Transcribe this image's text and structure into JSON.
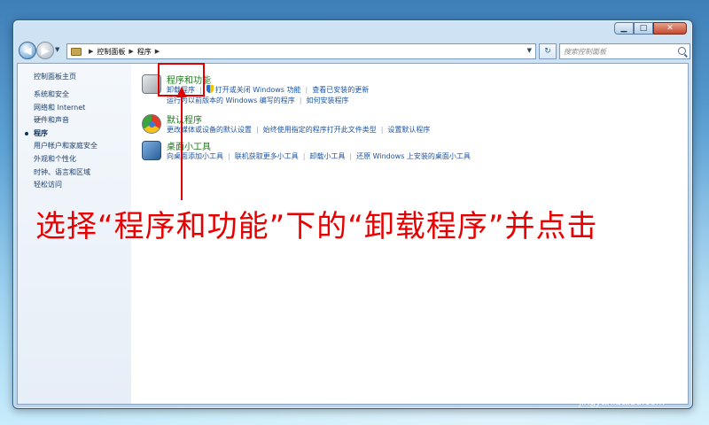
{
  "window": {
    "controls": {
      "minimize": "▁",
      "maximize": "□",
      "close": "✕"
    }
  },
  "address_bar": {
    "breadcrumbs": [
      "控制面板",
      "程序"
    ],
    "search_placeholder": "搜索控制面板"
  },
  "sidebar": {
    "home": "控制面板主页",
    "items": [
      {
        "label": "系统和安全"
      },
      {
        "label": "网络和 Internet"
      },
      {
        "label": "硬件和声音"
      },
      {
        "label": "程序",
        "active": true
      },
      {
        "label": "用户帐户和家庭安全"
      },
      {
        "label": "外观和个性化"
      },
      {
        "label": "时钟、语言和区域"
      },
      {
        "label": "轻松访问"
      }
    ]
  },
  "categories": [
    {
      "title": "程序和功能",
      "icon": "programs-icon",
      "link_rows": [
        [
          "卸载程序",
          "打开或关闭 Windows 功能",
          "查看已安装的更新"
        ],
        [
          "运行为以前版本的 Windows 编写的程序",
          "如何安装程序"
        ]
      ]
    },
    {
      "title": "默认程序",
      "icon": "default-programs-icon",
      "link_rows": [
        [
          "更改媒体或设备的默认设置",
          "始终使用指定的程序打开此文件类型",
          "设置默认程序"
        ]
      ]
    },
    {
      "title": "桌面小工具",
      "icon": "gadgets-icon",
      "link_rows": [
        [
          "向桌面添加小工具",
          "联机获取更多小工具",
          "卸载小工具",
          "还原 Windows 上安装的桌面小工具"
        ]
      ]
    }
  ],
  "annotation": {
    "instruction": "选择“程序和功能”下的“卸载程序”并点击",
    "highlight_color": "#e00000"
  },
  "watermark": {
    "logo": "Bai经验",
    "url": "jingyan.baidu.com"
  }
}
